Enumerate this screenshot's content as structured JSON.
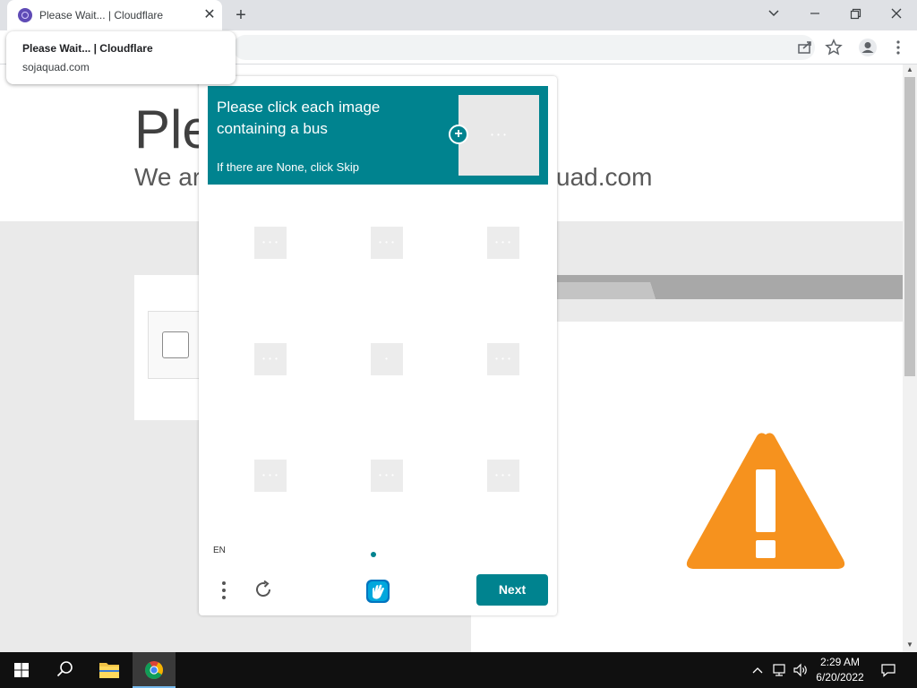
{
  "browser": {
    "tab_title": "Please Wait... | Cloudflare",
    "tab_close": "✕",
    "new_tab": "+",
    "hover_card": {
      "title": "Please Wait... | Cloudflare",
      "domain": "sojaquad.com"
    }
  },
  "page": {
    "hero_title_visible": "Ple",
    "hero_sub_left": "We ar",
    "hero_sub_right": "uad.com",
    "accent_color": "#f6921e"
  },
  "captcha": {
    "prompt": "Please click each image containing a bus",
    "skip_hint": "If there are None, click Skip",
    "expand_symbol": "+",
    "cells": [
      {
        "dots": "• • •"
      },
      {
        "dots": "• • •"
      },
      {
        "dots": "• • •"
      },
      {
        "dots": "• • •"
      },
      {
        "dots": "•"
      },
      {
        "dots": "• • •"
      },
      {
        "dots": "• • •"
      },
      {
        "dots": "• • •"
      },
      {
        "dots": "• • •"
      }
    ],
    "language": "EN",
    "next_label": "Next",
    "theme_color": "#00838f"
  },
  "taskbar": {
    "time": "2:29 AM",
    "date": "6/20/2022"
  }
}
